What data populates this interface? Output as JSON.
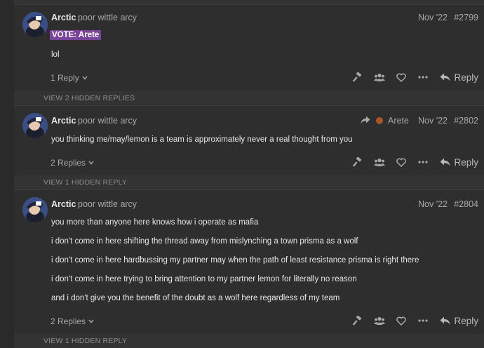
{
  "posts": [
    {
      "username": "Arctic",
      "user_title": "poor wittle arcy",
      "date": "Nov '22",
      "post_number": "#2799",
      "vote_text": "VOTE: Arete",
      "lines": [
        "lol"
      ],
      "replies_label": "1 Reply",
      "reply_label": "Reply"
    },
    {
      "username": "Arctic",
      "user_title": "poor wittle arcy",
      "reply_to_user": "Arete",
      "date": "Nov '22",
      "post_number": "#2802",
      "lines": [
        "you thinking me/may/lemon is a team is approximately never a real thought from you"
      ],
      "replies_label": "2 Replies",
      "reply_label": "Reply"
    },
    {
      "username": "Arctic",
      "user_title": "poor wittle arcy",
      "date": "Nov '22",
      "post_number": "#2804",
      "lines": [
        "you more than anyone here knows how i operate as mafia",
        "i don't come in here shifting the thread away from mislynching a town prisma as a wolf",
        "i don't come in here hardbussing my partner may when the path of least resistance prisma is right there",
        "i don't come in here trying to bring attention to my partner lemon for literally no reason",
        "and i don't give you the benefit of the doubt as a wolf here regardless of my team"
      ],
      "replies_label": "2 Replies",
      "reply_label": "Reply"
    }
  ],
  "hidden_replies": [
    "VIEW 2 HIDDEN REPLIES",
    "VIEW 1 HIDDEN REPLY",
    "VIEW 1 HIDDEN REPLY"
  ],
  "icons": [
    "hammer-icon",
    "group-icon",
    "heart-icon",
    "more-icon",
    "reply-arrow-icon",
    "chevron-down-icon",
    "share-arrow-icon"
  ],
  "colors": {
    "background": "#2a2a2a",
    "post_bg": "#2e2e2e",
    "vote_highlight": "#7a4598",
    "muted_text": "#a8a8a8"
  }
}
